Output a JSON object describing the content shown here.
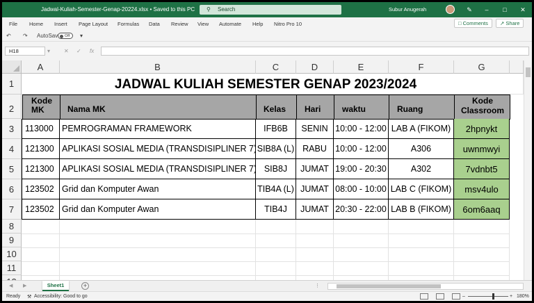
{
  "titlebar": {
    "document_title": "Jadwal-Kuliah-Semester-Genap-20224.xlsx  •  Saved to this PC",
    "search_placeholder": "Search",
    "user_name": "Subur Anugerah",
    "icons": {
      "search": "magnifier-icon",
      "minimize": "minimize-icon",
      "maximize": "maximize-icon",
      "close": "close-icon"
    }
  },
  "menu": {
    "items": [
      "File",
      "Home",
      "Insert",
      "Page Layout",
      "Formulas",
      "Data",
      "Review",
      "View",
      "Automate",
      "Help",
      "Nitro Pro 10"
    ],
    "comments_label": "Comments",
    "share_label": "Share"
  },
  "quick_access": {
    "autosave_label": "AutoSave",
    "autosave_state": "Off"
  },
  "formula_bar": {
    "name_box": "H18",
    "fx": "fx",
    "value": ""
  },
  "grid": {
    "columns": [
      "A",
      "B",
      "C",
      "D",
      "E",
      "F",
      "G"
    ],
    "rows": [
      "1",
      "2",
      "3",
      "4",
      "5",
      "6",
      "7",
      "8",
      "9",
      "10",
      "11",
      "12"
    ],
    "title": "JADWAL KULIAH SEMESTER GENAP 2023/2024",
    "headers": [
      "Kode MK",
      "Nama MK",
      "Kelas",
      "Hari",
      "waktu",
      "Ruang",
      "Kode Classroom"
    ],
    "header_bg": "#a6a6a6",
    "classroom_bg": "#a9d08e",
    "data_rows": [
      [
        "113000",
        "PEMROGRAMAN FRAMEWORK",
        "IFB6B",
        "SENIN",
        "10:00 - 12:00",
        "LAB A (FIKOM)",
        "2hpnykt"
      ],
      [
        "121300",
        "APLIKASI SOSIAL MEDIA (TRANSDISIPLINER 7)",
        "SIB8A (L)",
        "RABU",
        "10:00 - 12:00",
        "A306",
        "uwnmwyi"
      ],
      [
        "121300",
        "APLIKASI SOSIAL MEDIA (TRANSDISIPLINER 7)",
        "SIB8J",
        "JUMAT",
        "19:00 - 20:30",
        "A302",
        "7vdnbt5"
      ],
      [
        "123502",
        "Grid dan Komputer Awan",
        "TIB4A (L)",
        "JUMAT",
        "08:00 - 10:00",
        "LAB C (FIKOM)",
        "msv4ulo"
      ],
      [
        "123502",
        "Grid dan Komputer Awan",
        "TIB4J",
        "JUMAT",
        "20:30 - 22:00",
        "LAB B (FIKOM)",
        "6om6aaq"
      ]
    ]
  },
  "sheets": {
    "active": "Sheet1"
  },
  "status": {
    "ready": "Ready",
    "accessibility": "Accessibility: Good to go",
    "zoom": "180%"
  },
  "accent_color": "#1e7145"
}
